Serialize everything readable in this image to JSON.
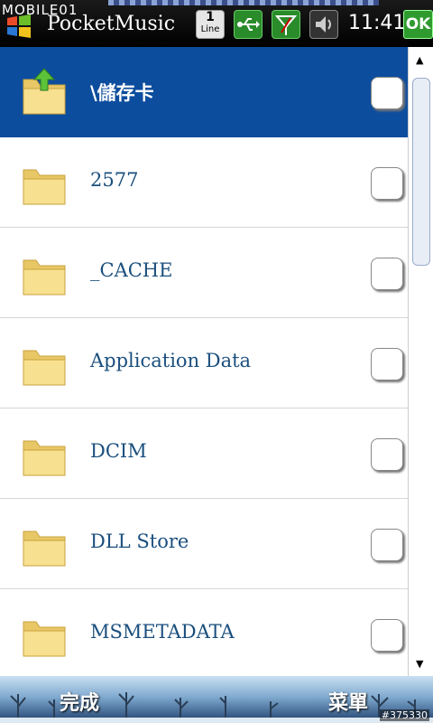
{
  "status_bar": {
    "watermark": "MOBILE01",
    "app_title": "PocketMusic",
    "line_icon": {
      "number": "1",
      "label": "Line"
    },
    "icons": [
      "windows-start-icon",
      "line-indicator-icon",
      "usb-icon",
      "signal-icon",
      "volume-icon"
    ],
    "time": "11:41",
    "ok_label": "OK"
  },
  "list": {
    "items": [
      {
        "label": "\\儲存卡",
        "icon": "folder-up-icon",
        "selected": true
      },
      {
        "label": "2577",
        "icon": "folder-icon",
        "selected": false
      },
      {
        "label": "_CACHE",
        "icon": "folder-icon",
        "selected": false
      },
      {
        "label": "Application Data",
        "icon": "folder-icon",
        "selected": false
      },
      {
        "label": "DCIM",
        "icon": "folder-icon",
        "selected": false
      },
      {
        "label": "DLL Store",
        "icon": "folder-icon",
        "selected": false
      },
      {
        "label": "MSMETADATA",
        "icon": "folder-icon",
        "selected": false
      }
    ]
  },
  "softkeys": {
    "left": "完成",
    "right": "菜單"
  },
  "image_number": "#375330",
  "colors": {
    "selected_row": "#0d4d9e",
    "item_text": "#1b4f7e",
    "ok_green": "#2f9b2f"
  }
}
